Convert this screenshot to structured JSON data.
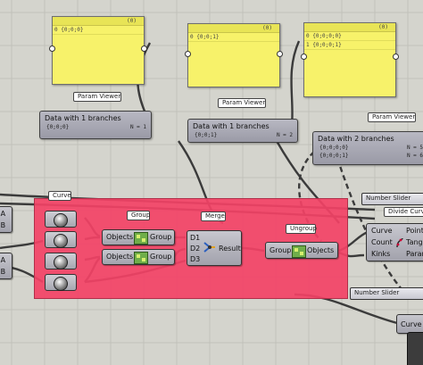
{
  "panels": [
    {
      "header": "(0)",
      "rows": [
        "0 {0;0;0}"
      ]
    },
    {
      "header": "(0)",
      "rows": [
        "0 {0;0;1}"
      ]
    },
    {
      "header": "(0)",
      "rows": [
        "0 {0;0;0;0}",
        "1 {0;0;0;1}"
      ]
    }
  ],
  "param_viewers": [
    {
      "tag": "Param Viewer",
      "title": "Data with 1 branches",
      "rows": [
        {
          "path": "{0;0;0}",
          "count": "N = 1"
        }
      ]
    },
    {
      "tag": "Param Viewer",
      "title": "Data with 1 branches",
      "rows": [
        {
          "path": "{0;0;1}",
          "count": "N = 2"
        }
      ]
    },
    {
      "tag": "Param Viewer",
      "title": "Data with 2 branches",
      "rows": [
        {
          "path": "{0;0;0;0}",
          "count": "N = 5"
        },
        {
          "path": "{0;0;0;1}",
          "count": "N = 6"
        }
      ]
    }
  ],
  "left_edge": {
    "labels": [
      "t A",
      "t B",
      "t A",
      "t B"
    ]
  },
  "group_tags": {
    "curve": "Curve",
    "group": "Group",
    "merge": "Merge",
    "ungroup": "Ungroup"
  },
  "group_comps": [
    {
      "input": "Objects",
      "output": "Group"
    },
    {
      "input": "Objects",
      "output": "Group"
    }
  ],
  "merge": {
    "inputs": [
      "D1",
      "D2",
      "D3"
    ],
    "output": "Result"
  },
  "ungroup": {
    "input": "Group",
    "output": "Objects"
  },
  "right_side": {
    "number_slider_top": "Number Slider",
    "divide_curve": "Divide Curve",
    "divide_inputs": [
      "Curve",
      "Count",
      "Kinks"
    ],
    "divide_outputs": [
      "Point",
      "Tange",
      "Paramete"
    ],
    "number_slider_bottom": "Number Slider",
    "curve_bottom": "Curve"
  },
  "colors": {
    "canvas": "#d4d4cd",
    "group": "#f34266",
    "panel": "#f7f26a"
  }
}
